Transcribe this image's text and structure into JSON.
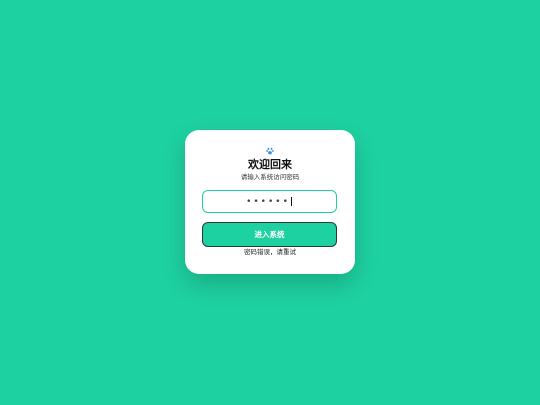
{
  "login": {
    "logo_icon": "paw-icon",
    "title": "欢迎回来",
    "subtitle": "请输入系统访问密码",
    "password_mask": "••••••",
    "submit_label": "进入系统",
    "error_message": "密码错误，请重试"
  },
  "colors": {
    "background": "#1ed1a0",
    "accent": "#1ed1a0",
    "card": "#ffffff"
  }
}
